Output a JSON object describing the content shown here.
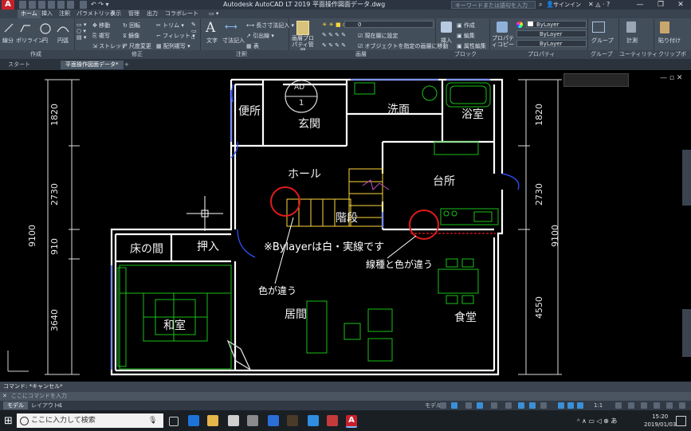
{
  "app": {
    "title": "Autodesk AutoCAD LT 2019   平面操作図面データ.dwg",
    "search_placeholder": "キーワードまたは語句を入力",
    "signin": "サインイン",
    "window_controls": [
      "—",
      "❐",
      "✕"
    ]
  },
  "menu_tabs": [
    "ホーム",
    "挿入",
    "注釈",
    "パラメトリック",
    "表示",
    "管理",
    "出力",
    "コラボレート"
  ],
  "ribbon": {
    "draw": {
      "line": "線分",
      "polyline": "ポリライン",
      "circle": "円",
      "arc": "円弧"
    },
    "modify": {
      "move": "移動",
      "rotate": "回転",
      "trim": "トリム",
      "copy": "複写",
      "mirror": "鏡像",
      "fillet": "フィレット",
      "stretch": "ストレッチ",
      "scale": "尺度変更",
      "array": "配列複写"
    },
    "annotation": {
      "text": "文字",
      "dimension": "寸法記入",
      "linear": "長さ寸法記入",
      "leader": "引出線",
      "table": "表"
    },
    "layers": {
      "layer_props": "画層プロパティ管理",
      "current_layer": "0",
      "make_current": "現在層に設定",
      "match_layer": "オブジェクトを指定の画層に移動"
    },
    "block": {
      "insert": "挿入",
      "create": "作成",
      "edit": "編集",
      "attrib": "属性編集"
    },
    "properties": {
      "match": "プロパティコピー",
      "color": "ByLayer",
      "linetype": "ByLayer",
      "lineweight": "ByLayer"
    },
    "group": "グループ",
    "utilities": "計測",
    "clipboard": "貼り付け"
  },
  "panel_labels": [
    "作成",
    "修正",
    "注釈",
    "画層",
    "ブロック",
    "プロパティ",
    "グループ",
    "ユーティリティ",
    "クリップボード"
  ],
  "file_tabs": [
    "スタート",
    "平面操作図面データ*",
    "+"
  ],
  "drawing": {
    "rooms": {
      "toilet": "便所",
      "entrance": "玄関",
      "washroom": "洗面",
      "bath": "浴室",
      "hall": "ホール",
      "kitchen": "台所",
      "stairs": "階段",
      "alcove": "床の間",
      "closet": "押入",
      "japanese_room": "和室",
      "living": "居間",
      "dining": "食堂"
    },
    "tag": {
      "code": "AD",
      "number": "1"
    },
    "dimensions": {
      "left_1820": "1820",
      "left_2730": "2730",
      "left_910": "910",
      "left_3640": "3640",
      "left_total": "9100",
      "right_1820": "1820",
      "right_2730": "2730",
      "right_4550": "4550",
      "right_total": "9100"
    },
    "annotations": {
      "note": "※Bylayerは白・実線です",
      "color_diff": "色が違う",
      "linetype_color_diff": "線種と色が違う"
    },
    "viewport_controls": "— ▫ ✕"
  },
  "command_line": {
    "history": "コマンド: *キャンセル*",
    "placeholder": "ここにコマンドを入力"
  },
  "layout_tabs": [
    "モデル",
    "レイアウト1",
    "+"
  ],
  "status_bar": {
    "mode": "モデル",
    "scale": "1:1"
  },
  "taskbar": {
    "search": "ここに入力して検索",
    "time": "15:20",
    "date": "2019/01/03"
  },
  "colors": {
    "wall": "#ffffff",
    "fixture": "#19c119",
    "yellow": "#ffd83a",
    "red": "#e21b1b",
    "magenta": "#c34ec3",
    "blue": "#3050ff",
    "ribbon_bg": "#434e5b"
  }
}
